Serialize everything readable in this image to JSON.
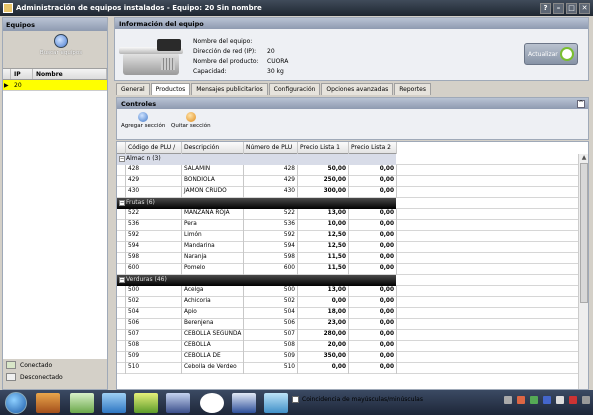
{
  "window": {
    "title": "Administración de equipos instalados - Equipo: 20 Sin nombre"
  },
  "left_pane": {
    "header": "Equipos",
    "search_label": "Buscar equipos",
    "columns": [
      "IP",
      "Nombre"
    ],
    "rows": [
      {
        "ip": "20",
        "nombre": "",
        "selected": true
      }
    ],
    "legend": [
      {
        "label": "Conectado",
        "color": "#d8e6c8"
      },
      {
        "label": "Desconectado",
        "color": "#f0f0f0"
      }
    ]
  },
  "info": {
    "header": "Información del equipo",
    "fields": [
      {
        "key": "Nombre del equipo:",
        "value": ""
      },
      {
        "key": "Dirección de red (IP):",
        "value": "20"
      },
      {
        "key": "Nombre del producto:",
        "value": "CUORA"
      },
      {
        "key": "Capacidad:",
        "value": "30 kg"
      }
    ],
    "refresh_label": "Actualizar"
  },
  "tabs": [
    {
      "label": "General",
      "active": false
    },
    {
      "label": "Productos",
      "active": true
    },
    {
      "label": "Mensajes publicitarios",
      "active": false
    },
    {
      "label": "Configuración",
      "active": false
    },
    {
      "label": "Opciones avanzadas",
      "active": false
    },
    {
      "label": "Reportes",
      "active": false
    }
  ],
  "controls": {
    "header": "Controles",
    "add_label": "Agregar sección",
    "remove_label": "Quitar sección"
  },
  "grid": {
    "columns": [
      "Código de PLU",
      "Descripción",
      "Número de PLU",
      "Precio Lista 1",
      "Precio Lista 2"
    ],
    "groups": [
      {
        "title": "Almac n (3)",
        "rows": [
          [
            "428",
            "SALAMIN",
            "428",
            "50,00",
            "0,00"
          ],
          [
            "429",
            "BONDIOLA",
            "429",
            "250,00",
            "0,00"
          ],
          [
            "430",
            "JAMON CRUDO",
            "430",
            "300,00",
            "0,00"
          ]
        ]
      },
      {
        "title": "Frutas (6)",
        "rows": [
          [
            "522",
            "MANZANA ROJA",
            "522",
            "13,00",
            "0,00"
          ],
          [
            "536",
            "Pera",
            "536",
            "10,00",
            "0,00"
          ],
          [
            "592",
            "Limón",
            "592",
            "12,50",
            "0,00"
          ],
          [
            "594",
            "Mandarina",
            "594",
            "12,50",
            "0,00"
          ],
          [
            "598",
            "Naranja",
            "598",
            "11,50",
            "0,00"
          ],
          [
            "600",
            "Pomelo",
            "600",
            "11,50",
            "0,00"
          ]
        ]
      },
      {
        "title": "Verduras (46)",
        "rows": [
          [
            "500",
            "Acelga",
            "500",
            "13,00",
            "0,00"
          ],
          [
            "502",
            "Achicoria",
            "502",
            "0,00",
            "0,00"
          ],
          [
            "504",
            "Apio",
            "504",
            "18,00",
            "0,00"
          ],
          [
            "506",
            "Berenjena",
            "506",
            "23,00",
            "0,00"
          ],
          [
            "507",
            "CEBOLLA SEGUNDA",
            "507",
            "280,00",
            "0,00"
          ],
          [
            "508",
            "CEBOLLA",
            "508",
            "20,00",
            "0,00"
          ],
          [
            "509",
            "CEBOLLA DE",
            "509",
            "350,00",
            "0,00"
          ],
          [
            "510",
            "Cebolla de Verdeo",
            "510",
            "0,00",
            "0,00"
          ]
        ]
      }
    ]
  },
  "find": {
    "label": "Coincidencia de mayúsculas/minúsculas"
  }
}
